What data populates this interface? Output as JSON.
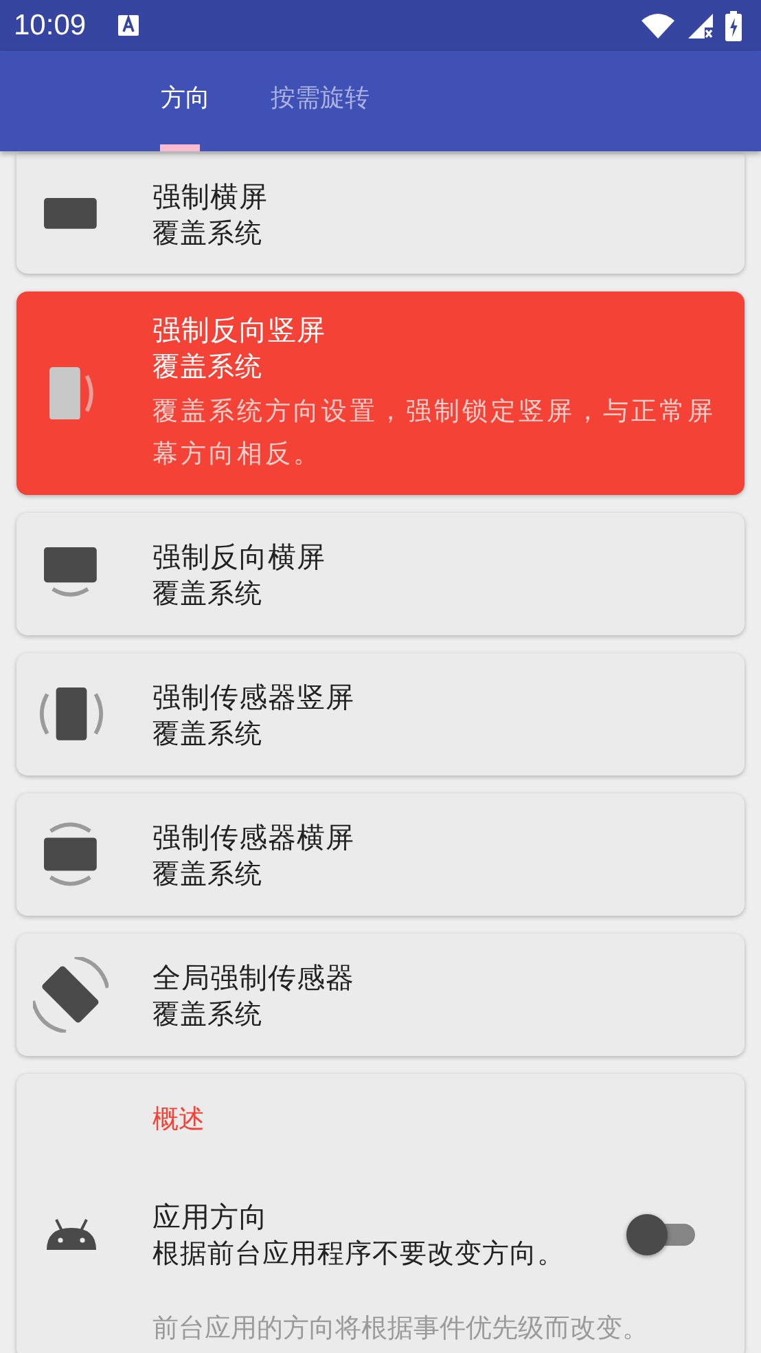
{
  "status_bar": {
    "time": "10:09"
  },
  "tabs": [
    {
      "label": "方向",
      "selected": true
    },
    {
      "label": "按需旋转",
      "selected": false
    }
  ],
  "options": [
    {
      "kind": "landscape",
      "title": "强制横屏",
      "subtitle": "覆盖系统",
      "selected": false
    },
    {
      "kind": "reverse_portrait",
      "title": "强制反向竖屏",
      "subtitle": "覆盖系统",
      "selected": true,
      "description": "覆盖系统方向设置，强制锁定竖屏，与正常屏幕方向相反。"
    },
    {
      "kind": "reverse_landscape",
      "title": "强制反向横屏",
      "subtitle": "覆盖系统",
      "selected": false
    },
    {
      "kind": "sensor_portrait",
      "title": "强制传感器竖屏",
      "subtitle": "覆盖系统",
      "selected": false
    },
    {
      "kind": "sensor_landscape",
      "title": "强制传感器横屏",
      "subtitle": "覆盖系统",
      "selected": false
    },
    {
      "kind": "full_sensor",
      "title": "全局强制传感器",
      "subtitle": "覆盖系统",
      "selected": false
    }
  ],
  "overview": {
    "header": "概述",
    "title": "应用方向",
    "summary": "根据前台应用程序不要改变方向。",
    "on": false,
    "description": "前台应用的方向将根据事件优先级而改变。"
  }
}
